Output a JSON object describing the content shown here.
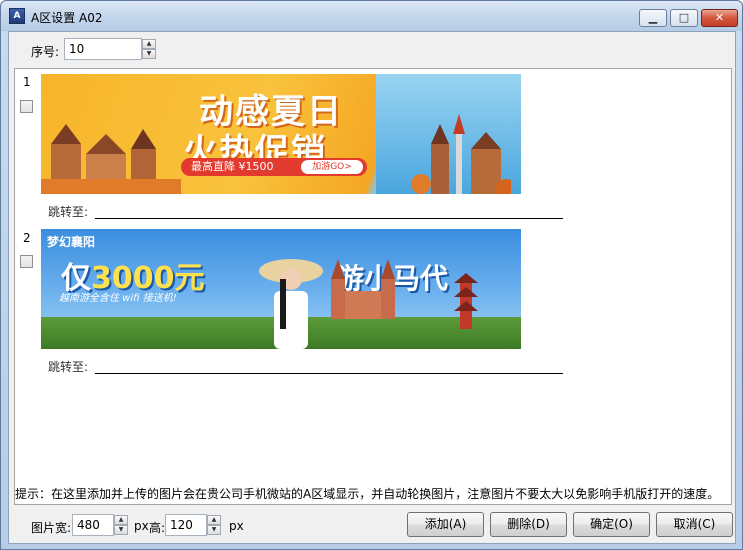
{
  "window": {
    "icon_text": "A",
    "title": "A区设置 A02",
    "minimize_glyph": "▁",
    "maximize_glyph": "□",
    "close_glyph": "✕"
  },
  "serial": {
    "label": "序号:",
    "value": "10"
  },
  "items": [
    {
      "number": "1",
      "checked": false,
      "jump_label": "跳转至:",
      "jump_value": "",
      "banner": {
        "headline_1": "动感夏日",
        "headline_2": "火热促销",
        "price_text": "最高直降 ¥1500",
        "cta_text": "加游GO>"
      }
    },
    {
      "number": "2",
      "checked": false,
      "jump_label": "跳转至:",
      "jump_value": "",
      "banner": {
        "logo_text": "梦幻襄阳",
        "big_prefix": "仅",
        "big_number": "3000元",
        "sub_text": "越南游全含住 wifi 接送机!",
        "right_title": "游小马代"
      }
    }
  ],
  "hint": "提示：在这里添加并上传的图片会在贵公司手机微站的A区域显示，并自动轮换图片，注意图片不要太大以免影响手机版打开的速度。",
  "image_size": {
    "width_label": "图片宽:",
    "width_value": "480",
    "width_unit": "px",
    "height_label": "高:",
    "height_value": "120",
    "height_unit": "px"
  },
  "buttons": {
    "add": "添加(A)",
    "delete": "删除(D)",
    "ok": "确定(O)",
    "cancel": "取消(C)"
  }
}
